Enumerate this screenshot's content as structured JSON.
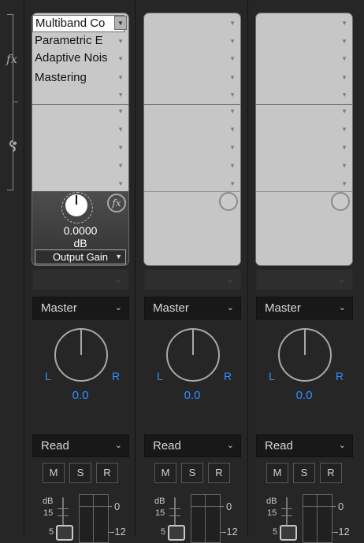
{
  "channels": [
    {
      "rack_effects": [
        "Multiband Co",
        "Parametric E",
        "Adaptive Nois",
        "Mastering"
      ],
      "gain_value": "0.0000",
      "gain_unit": "dB",
      "output_label": "Output Gain",
      "bus": "Master",
      "pan_left": "L",
      "pan_right": "R",
      "pan_value": "0.0",
      "automation": "Read",
      "mute": "M",
      "solo": "S",
      "record": "R",
      "db_label": "dB",
      "db15": "15",
      "db5": "5",
      "meter0": "0",
      "meter12": "-12"
    },
    {
      "bus": "Master",
      "pan_left": "L",
      "pan_right": "R",
      "pan_value": "0.0",
      "automation": "Read",
      "mute": "M",
      "solo": "S",
      "record": "R",
      "db_label": "dB",
      "db15": "15",
      "db5": "5",
      "meter0": "0",
      "meter12": "-12"
    },
    {
      "bus": "Master",
      "pan_left": "L",
      "pan_right": "R",
      "pan_value": "0.0",
      "automation": "Read",
      "mute": "M",
      "solo": "S",
      "record": "R",
      "db_label": "dB",
      "db15": "15",
      "db5": "5",
      "meter0": "0",
      "meter12": "-12"
    }
  ],
  "sidebar": {
    "fx_label": "fx"
  }
}
